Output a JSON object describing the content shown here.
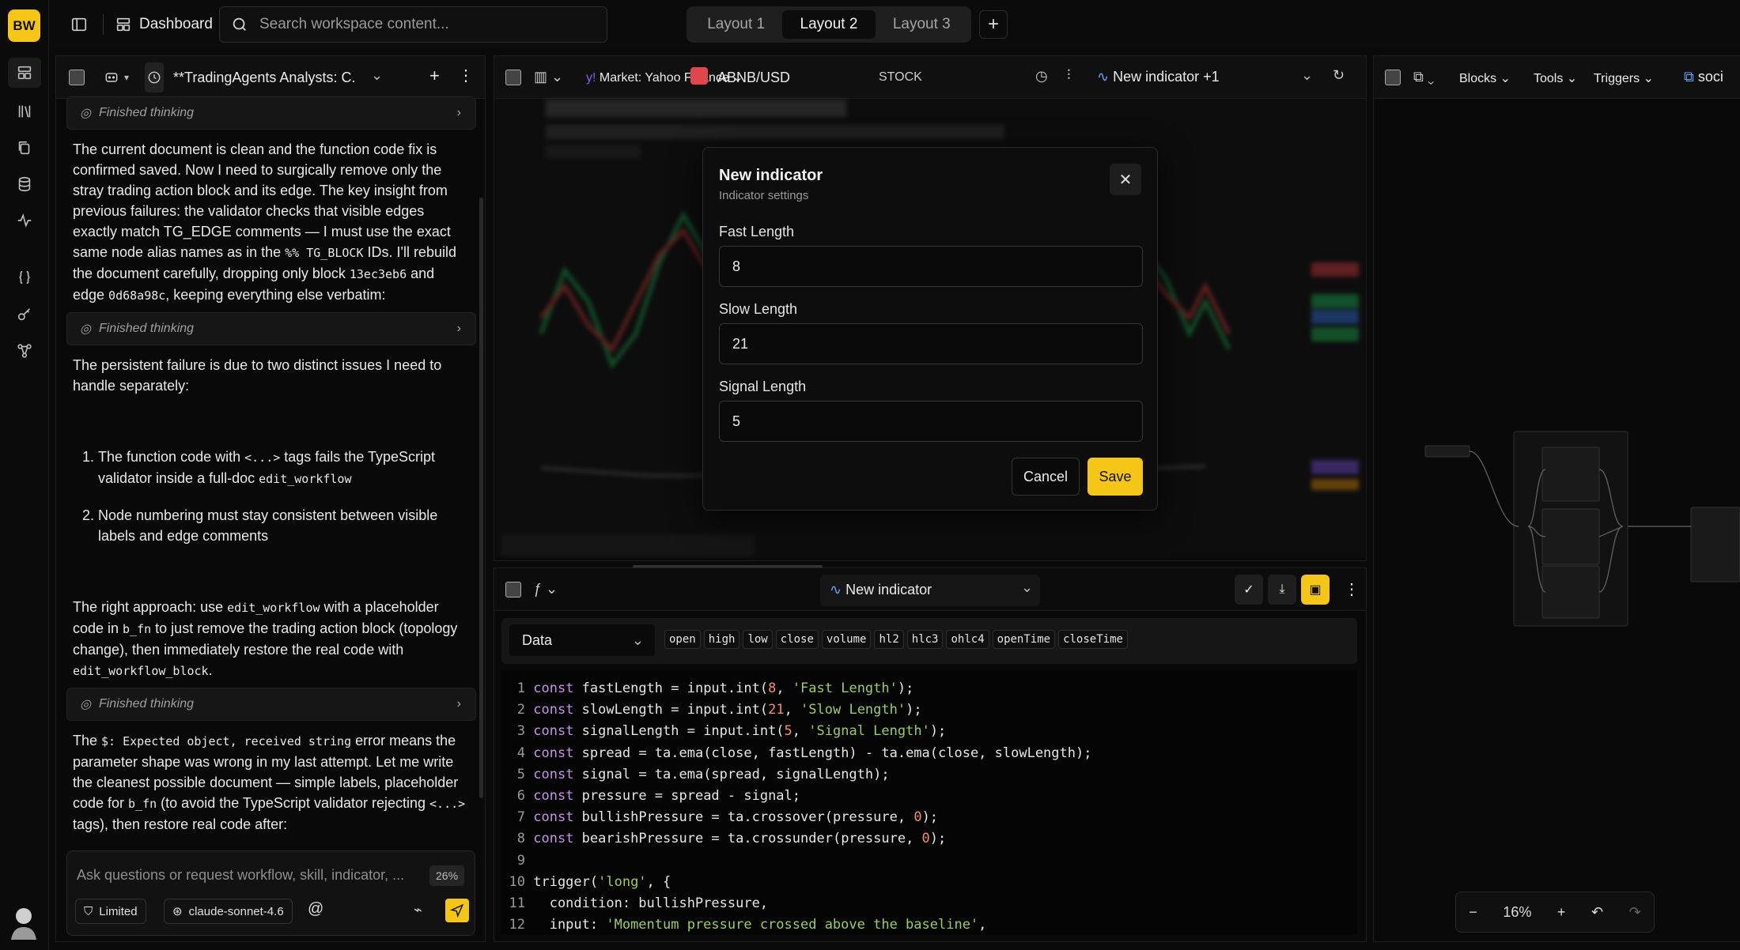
{
  "user": {
    "initials": "BW"
  },
  "topbar": {
    "title": "Dashboard",
    "search_placeholder": "Search workspace content...",
    "layouts": [
      "Layout 1",
      "Layout 2",
      "Layout 3"
    ],
    "active_layout": "Layout 2"
  },
  "chat": {
    "title": "**TradingAgents Analysts: C...",
    "thinking_label": "Finished thinking",
    "p1": [
      "The current document is clean and the function code fix is confirmed saved. Now I need to surgically remove only the stray trading action block and its edge. The key insight from previous failures: the validator checks that visible edges exactly match TG_EDGE comments — I must use the exact same node alias names as in the ",
      "%% TG_BLOCK",
      " IDs. I'll rebuild the document carefully, dropping only block ",
      "13ec3eb6",
      " and edge ",
      "0d68a98c",
      ", keeping everything else verbatim:"
    ],
    "p2": "The persistent failure is due to two distinct issues I need to handle separately:",
    "list": [
      [
        "The function code with ",
        "<...>",
        " tags fails the TypeScript validator inside a full-doc ",
        "edit_workflow",
        ""
      ],
      [
        "Node numbering must stay consistent between visible labels and edge comments",
        "",
        "",
        "",
        ""
      ]
    ],
    "p3": [
      "The right approach: use ",
      "edit_workflow",
      " with a placeholder code in ",
      "b_fn",
      " to just remove the trading action block (topology change), then immediately restore the real code with ",
      "edit_workflow_block",
      "."
    ],
    "p4": [
      "The ",
      "$: Expected object, received string",
      " error means the parameter shape was wrong in my last attempt. Let me write the cleanest possible document — simple labels, placeholder code for ",
      "b_fn",
      " (to avoid the TypeScript validator rejecting ",
      "<...>",
      " tags), then restore real code after:"
    ],
    "input_placeholder": "Ask questions or request workflow, skill, indicator, ...",
    "context_usage": "26%",
    "access": "Limited",
    "model": "claude-sonnet-4.6",
    "mention": "@"
  },
  "chart": {
    "market": "Market: Yahoo Finance",
    "symbol": "ABNB/USD",
    "asset_type": "STOCK",
    "indicator_select": "New indicator +1"
  },
  "modal": {
    "title": "New indicator",
    "subtitle": "Indicator settings",
    "fields": [
      {
        "label": "Fast Length",
        "value": "8"
      },
      {
        "label": "Slow Length",
        "value": "21"
      },
      {
        "label": "Signal Length",
        "value": "5"
      }
    ],
    "cancel": "Cancel",
    "save": "Save"
  },
  "editor": {
    "indicator_select": "New indicator",
    "data_select": "Data",
    "fields": [
      "open",
      "high",
      "low",
      "close",
      "volume",
      "hl2",
      "hlc3",
      "ohlc4",
      "openTime",
      "closeTime"
    ]
  },
  "flow": {
    "menus": [
      "Blocks",
      "Tools",
      "Triggers"
    ],
    "tab": "soci",
    "zoom": "16%"
  },
  "colors": {
    "accent": "#f5c518",
    "background": "#0a0a0a"
  }
}
